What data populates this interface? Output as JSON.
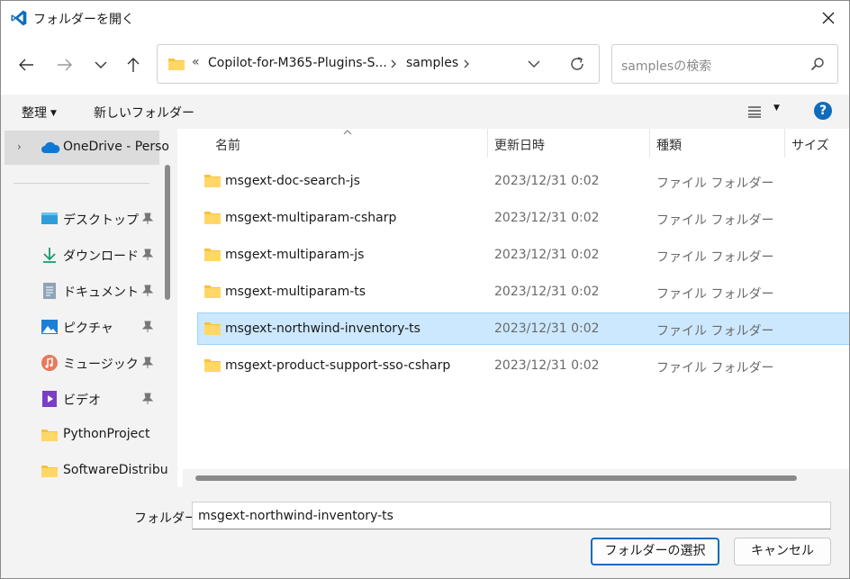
{
  "window": {
    "title": "フォルダーを開く",
    "accent": "#0f6cbd"
  },
  "address": {
    "overflow": "«",
    "crumbs": [
      "Copilot-for-M365-Plugins-S...",
      "samples"
    ]
  },
  "search": {
    "placeholder": "samplesの検索"
  },
  "toolbar": {
    "organize": "整理",
    "new_folder": "新しいフォルダー",
    "help": "?"
  },
  "sidebar": {
    "onedrive": "OneDrive - Perso",
    "items": [
      {
        "label": "デスクトップ",
        "icon": "desktop-icon",
        "pinned": true
      },
      {
        "label": "ダウンロード",
        "icon": "download-icon",
        "pinned": true
      },
      {
        "label": "ドキュメント",
        "icon": "document-icon",
        "pinned": true
      },
      {
        "label": "ピクチャ",
        "icon": "pictures-icon",
        "pinned": true
      },
      {
        "label": "ミュージック",
        "icon": "music-icon",
        "pinned": true
      },
      {
        "label": "ビデオ",
        "icon": "video-icon",
        "pinned": true
      },
      {
        "label": "PythonProject",
        "icon": "folder-icon",
        "pinned": false
      },
      {
        "label": "SoftwareDistribu",
        "icon": "folder-icon",
        "pinned": false
      }
    ]
  },
  "columns": {
    "name": "名前",
    "modified": "更新日時",
    "type": "種類",
    "size": "サイズ"
  },
  "files": [
    {
      "name": "msgext-doc-search-js",
      "modified": "2023/12/31 0:02",
      "type": "ファイル フォルダー",
      "selected": false
    },
    {
      "name": "msgext-multiparam-csharp",
      "modified": "2023/12/31 0:02",
      "type": "ファイル フォルダー",
      "selected": false
    },
    {
      "name": "msgext-multiparam-js",
      "modified": "2023/12/31 0:02",
      "type": "ファイル フォルダー",
      "selected": false
    },
    {
      "name": "msgext-multiparam-ts",
      "modified": "2023/12/31 0:02",
      "type": "ファイル フォルダー",
      "selected": false
    },
    {
      "name": "msgext-northwind-inventory-ts",
      "modified": "2023/12/31 0:02",
      "type": "ファイル フォルダー",
      "selected": true
    },
    {
      "name": "msgext-product-support-sso-csharp",
      "modified": "2023/12/31 0:02",
      "type": "ファイル フォルダー",
      "selected": false
    }
  ],
  "footer": {
    "folder_label": "フォルダー:",
    "folder_value": "msgext-northwind-inventory-ts",
    "select_button": "フォルダーの選択",
    "cancel_button": "キャンセル"
  }
}
